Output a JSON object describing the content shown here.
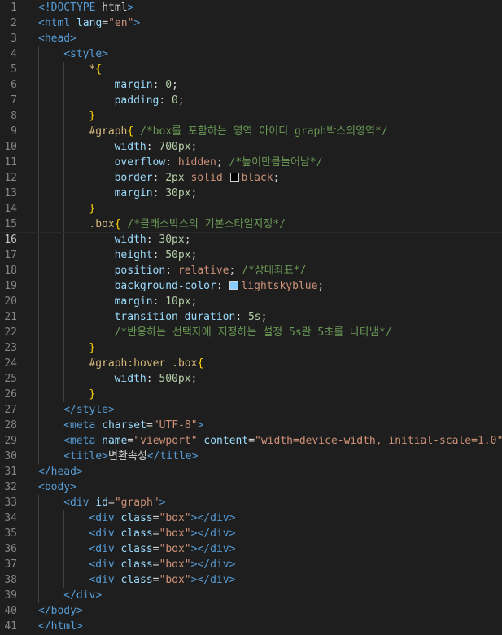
{
  "editor": {
    "language": "html",
    "current_line": 16,
    "colors": {
      "background": "#1e1e1e",
      "tag": "#569cd6",
      "attribute": "#9cdcfe",
      "string": "#ce9178",
      "selector": "#d7ba7d",
      "number": "#b5cea8",
      "comment": "#6a9955",
      "brace": "#ffd700"
    },
    "lines": [
      {
        "n": 1,
        "indent": 0,
        "tokens": [
          [
            "tag",
            "<!DOCTYPE "
          ],
          [
            "plain",
            "html"
          ],
          [
            "tag",
            ">"
          ]
        ]
      },
      {
        "n": 2,
        "indent": 0,
        "tokens": [
          [
            "tag",
            "<html "
          ],
          [
            "attr",
            "lang"
          ],
          [
            "plain",
            "="
          ],
          [
            "str",
            "\"en\""
          ],
          [
            "tag",
            ">"
          ]
        ]
      },
      {
        "n": 3,
        "indent": 0,
        "tokens": [
          [
            "tag",
            "<head>"
          ]
        ]
      },
      {
        "n": 4,
        "indent": 1,
        "tokens": [
          [
            "tag",
            "<style>"
          ]
        ]
      },
      {
        "n": 5,
        "indent": 2,
        "tokens": [
          [
            "sel",
            "*"
          ],
          [
            "brace",
            "{"
          ]
        ]
      },
      {
        "n": 6,
        "indent": 3,
        "tokens": [
          [
            "prop",
            "margin"
          ],
          [
            "plain",
            ": "
          ],
          [
            "num",
            "0"
          ],
          [
            "plain",
            ";"
          ]
        ]
      },
      {
        "n": 7,
        "indent": 3,
        "tokens": [
          [
            "prop",
            "padding"
          ],
          [
            "plain",
            ": "
          ],
          [
            "num",
            "0"
          ],
          [
            "plain",
            ";"
          ]
        ]
      },
      {
        "n": 8,
        "indent": 2,
        "tokens": [
          [
            "brace",
            "}"
          ]
        ]
      },
      {
        "n": 9,
        "indent": 2,
        "tokens": [
          [
            "sel",
            "#graph"
          ],
          [
            "brace",
            "{"
          ],
          [
            "plain",
            " "
          ],
          [
            "com",
            "/*box를 포함하는 영역 아이디 graph박스의영역*/"
          ]
        ]
      },
      {
        "n": 10,
        "indent": 3,
        "tokens": [
          [
            "prop",
            "width"
          ],
          [
            "plain",
            ": "
          ],
          [
            "num",
            "700px"
          ],
          [
            "plain",
            ";"
          ]
        ]
      },
      {
        "n": 11,
        "indent": 3,
        "tokens": [
          [
            "prop",
            "overflow"
          ],
          [
            "plain",
            ": "
          ],
          [
            "val",
            "hidden"
          ],
          [
            "plain",
            "; "
          ],
          [
            "com",
            "/*높이만큼늘어남*/"
          ]
        ]
      },
      {
        "n": 12,
        "indent": 3,
        "tokens": [
          [
            "prop",
            "border"
          ],
          [
            "plain",
            ": "
          ],
          [
            "num",
            "2px"
          ],
          [
            "plain",
            " "
          ],
          [
            "val",
            "solid"
          ],
          [
            "plain",
            " "
          ],
          [
            "swatch",
            "#000000"
          ],
          [
            "val",
            "black"
          ],
          [
            "plain",
            ";"
          ]
        ]
      },
      {
        "n": 13,
        "indent": 3,
        "tokens": [
          [
            "prop",
            "margin"
          ],
          [
            "plain",
            ": "
          ],
          [
            "num",
            "30px"
          ],
          [
            "plain",
            ";"
          ]
        ]
      },
      {
        "n": 14,
        "indent": 2,
        "tokens": [
          [
            "brace",
            "}"
          ]
        ]
      },
      {
        "n": 15,
        "indent": 2,
        "tokens": [
          [
            "sel",
            ".box"
          ],
          [
            "brace",
            "{"
          ],
          [
            "plain",
            " "
          ],
          [
            "com",
            "/*클래스박스의 기본스타일지정*/"
          ]
        ]
      },
      {
        "n": 16,
        "indent": 3,
        "tokens": [
          [
            "prop",
            "width"
          ],
          [
            "plain",
            ": "
          ],
          [
            "num",
            "30px"
          ],
          [
            "plain",
            ";"
          ]
        ]
      },
      {
        "n": 17,
        "indent": 3,
        "tokens": [
          [
            "prop",
            "height"
          ],
          [
            "plain",
            ": "
          ],
          [
            "num",
            "50px"
          ],
          [
            "plain",
            ";"
          ]
        ]
      },
      {
        "n": 18,
        "indent": 3,
        "tokens": [
          [
            "prop",
            "position"
          ],
          [
            "plain",
            ": "
          ],
          [
            "val",
            "relative"
          ],
          [
            "plain",
            "; "
          ],
          [
            "com",
            "/*상대좌표*/"
          ]
        ]
      },
      {
        "n": 19,
        "indent": 3,
        "tokens": [
          [
            "prop",
            "background-color"
          ],
          [
            "plain",
            ": "
          ],
          [
            "swatch",
            "#87cefa"
          ],
          [
            "val",
            "lightskyblue"
          ],
          [
            "plain",
            ";"
          ]
        ]
      },
      {
        "n": 20,
        "indent": 3,
        "tokens": [
          [
            "prop",
            "margin"
          ],
          [
            "plain",
            ": "
          ],
          [
            "num",
            "10px"
          ],
          [
            "plain",
            ";"
          ]
        ]
      },
      {
        "n": 21,
        "indent": 3,
        "tokens": [
          [
            "prop",
            "transition-duration"
          ],
          [
            "plain",
            ": "
          ],
          [
            "num",
            "5s"
          ],
          [
            "plain",
            ";"
          ]
        ]
      },
      {
        "n": 22,
        "indent": 3,
        "tokens": [
          [
            "com",
            "/*반응하는 선택자에 지정하는 설정 5s란 5초를 나타냄*/"
          ]
        ]
      },
      {
        "n": 23,
        "indent": 2,
        "tokens": [
          [
            "brace",
            "}"
          ]
        ]
      },
      {
        "n": 24,
        "indent": 2,
        "tokens": [
          [
            "sel",
            "#graph:hover .box"
          ],
          [
            "brace",
            "{"
          ]
        ]
      },
      {
        "n": 25,
        "indent": 3,
        "tokens": [
          [
            "prop",
            "width"
          ],
          [
            "plain",
            ": "
          ],
          [
            "num",
            "500px"
          ],
          [
            "plain",
            ";"
          ]
        ]
      },
      {
        "n": 26,
        "indent": 2,
        "tokens": [
          [
            "brace",
            "}"
          ]
        ]
      },
      {
        "n": 27,
        "indent": 1,
        "tokens": [
          [
            "tag",
            "</style>"
          ]
        ]
      },
      {
        "n": 28,
        "indent": 1,
        "tokens": [
          [
            "tag",
            "<meta "
          ],
          [
            "attr",
            "charset"
          ],
          [
            "plain",
            "="
          ],
          [
            "str",
            "\"UTF-8\""
          ],
          [
            "tag",
            ">"
          ]
        ]
      },
      {
        "n": 29,
        "indent": 1,
        "tokens": [
          [
            "tag",
            "<meta "
          ],
          [
            "attr",
            "name"
          ],
          [
            "plain",
            "="
          ],
          [
            "str",
            "\"viewport\""
          ],
          [
            "plain",
            " "
          ],
          [
            "attr",
            "content"
          ],
          [
            "plain",
            "="
          ],
          [
            "str",
            "\"width=device-width, initial-scale=1.0\""
          ],
          [
            "tag",
            ">"
          ]
        ]
      },
      {
        "n": 30,
        "indent": 1,
        "tokens": [
          [
            "tag",
            "<title>"
          ],
          [
            "plain",
            "변환속성"
          ],
          [
            "tag",
            "</title>"
          ]
        ]
      },
      {
        "n": 31,
        "indent": 0,
        "tokens": [
          [
            "tag",
            "</head>"
          ]
        ]
      },
      {
        "n": 32,
        "indent": 0,
        "tokens": [
          [
            "tag",
            "<body>"
          ]
        ]
      },
      {
        "n": 33,
        "indent": 1,
        "tokens": [
          [
            "tag",
            "<div "
          ],
          [
            "attr",
            "id"
          ],
          [
            "plain",
            "="
          ],
          [
            "str",
            "\"graph\""
          ],
          [
            "tag",
            ">"
          ]
        ]
      },
      {
        "n": 34,
        "indent": 2,
        "tokens": [
          [
            "tag",
            "<div "
          ],
          [
            "attr",
            "class"
          ],
          [
            "plain",
            "="
          ],
          [
            "str",
            "\"box\""
          ],
          [
            "tag",
            "></div>"
          ]
        ]
      },
      {
        "n": 35,
        "indent": 2,
        "tokens": [
          [
            "tag",
            "<div "
          ],
          [
            "attr",
            "class"
          ],
          [
            "plain",
            "="
          ],
          [
            "str",
            "\"box\""
          ],
          [
            "tag",
            "></div>"
          ]
        ]
      },
      {
        "n": 36,
        "indent": 2,
        "tokens": [
          [
            "tag",
            "<div "
          ],
          [
            "attr",
            "class"
          ],
          [
            "plain",
            "="
          ],
          [
            "str",
            "\"box\""
          ],
          [
            "tag",
            "></div>"
          ]
        ]
      },
      {
        "n": 37,
        "indent": 2,
        "tokens": [
          [
            "tag",
            "<div "
          ],
          [
            "attr",
            "class"
          ],
          [
            "plain",
            "="
          ],
          [
            "str",
            "\"box\""
          ],
          [
            "tag",
            "></div>"
          ]
        ]
      },
      {
        "n": 38,
        "indent": 2,
        "tokens": [
          [
            "tag",
            "<div "
          ],
          [
            "attr",
            "class"
          ],
          [
            "plain",
            "="
          ],
          [
            "str",
            "\"box\""
          ],
          [
            "tag",
            "></div>"
          ]
        ]
      },
      {
        "n": 39,
        "indent": 1,
        "tokens": [
          [
            "tag",
            "</div>"
          ]
        ]
      },
      {
        "n": 40,
        "indent": 0,
        "tokens": [
          [
            "tag",
            "</body>"
          ]
        ]
      },
      {
        "n": 41,
        "indent": 0,
        "tokens": [
          [
            "tag",
            "</html>"
          ]
        ]
      }
    ]
  }
}
